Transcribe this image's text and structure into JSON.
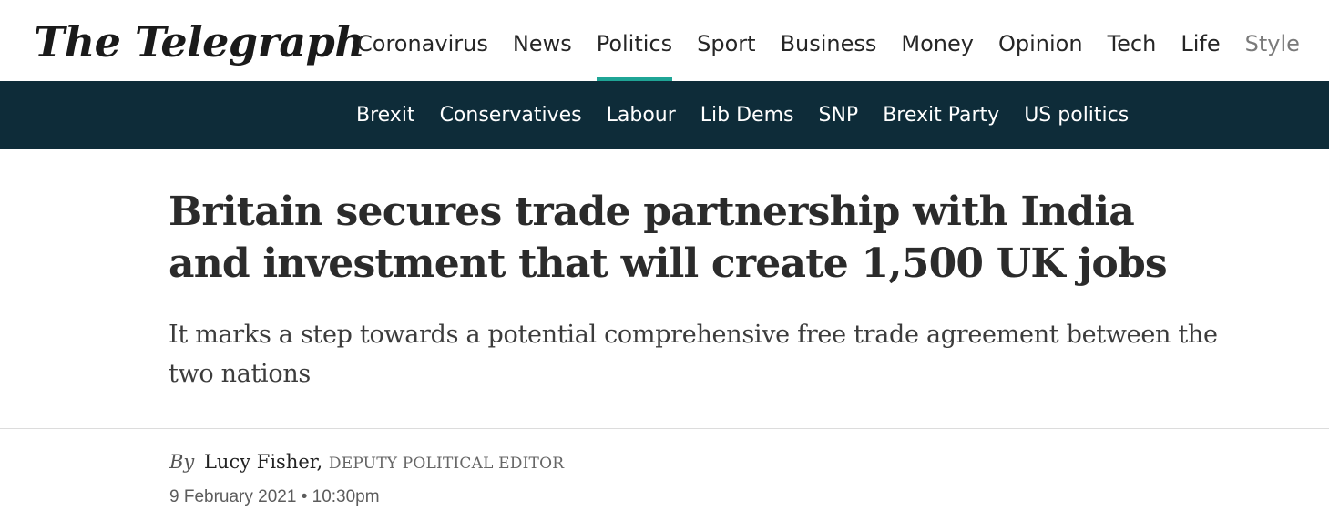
{
  "masthead": {
    "logo": "The Telegraph",
    "nav": [
      {
        "label": "Coronavirus",
        "active": false
      },
      {
        "label": "News",
        "active": false
      },
      {
        "label": "Politics",
        "active": true
      },
      {
        "label": "Sport",
        "active": false
      },
      {
        "label": "Business",
        "active": false
      },
      {
        "label": "Money",
        "active": false
      },
      {
        "label": "Opinion",
        "active": false
      },
      {
        "label": "Tech",
        "active": false
      },
      {
        "label": "Life",
        "active": false
      },
      {
        "label": "Style",
        "active": false
      }
    ]
  },
  "subnav": {
    "items": [
      "Brexit",
      "Conservatives",
      "Labour",
      "Lib Dems",
      "SNP",
      "Brexit Party",
      "US politics"
    ]
  },
  "article": {
    "headline": "Britain secures trade partnership with India and investment that will create 1,500 UK jobs",
    "standfirst": "It marks a step towards a potential comprehensive free trade agreement between the two nations",
    "byline_prefix": "By",
    "author": "Lucy Fisher",
    "author_separator": ",",
    "author_role": "DEPUTY POLITICAL EDITOR",
    "date": "9 February 2021",
    "date_separator": "•",
    "time": "10:30pm"
  },
  "colors": {
    "subnav_bg": "#0e2c39",
    "active_underline": "#1fa596",
    "text": "#2b2b2b"
  }
}
